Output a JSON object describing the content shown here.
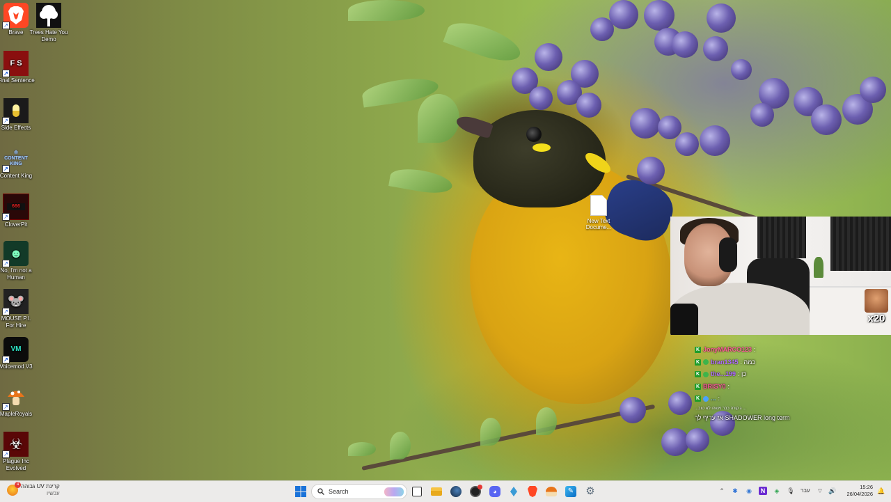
{
  "desktop": {
    "icons": [
      {
        "label": "Brave",
        "icon": "brave-lion-icon",
        "bg": "#ff4724"
      },
      {
        "label": "Trees Hate You Demo",
        "icon": "tree-icon",
        "bg": "#111111"
      },
      {
        "label": "Final Sentence",
        "icon": "fs-logo-icon",
        "bg": "#8a0f0f"
      },
      {
        "label": "Side Effects",
        "icon": "pill-icon",
        "bg": "#1a1a1a"
      },
      {
        "label": "Content King",
        "icon": "crown-logo-icon",
        "bg": "#2b2b6a"
      },
      {
        "label": "CloverPit",
        "icon": "slot-machine-icon",
        "bg": "#3a0d0d"
      },
      {
        "label": "No, I'm not a Human",
        "icon": "face-icon",
        "bg": "#1a3a2a"
      },
      {
        "label": "MOUSE P.I. For Hire",
        "icon": "mouse-detective-icon",
        "bg": "#222222"
      },
      {
        "label": "Voicemod V3",
        "icon": "voicemod-icon",
        "bg": "#0b0b0b"
      },
      {
        "label": "MapleRoyals",
        "icon": "mushroom-icon",
        "bg": "#4b2a12"
      },
      {
        "label": "Plague Inc Evolved",
        "icon": "biohazard-icon",
        "bg": "#4a0707"
      }
    ],
    "newfile_label": "New Text Docume..."
  },
  "webcam": {
    "badge_text": "x20"
  },
  "chat": {
    "messages": [
      {
        "user": "JonyMARCO123",
        "text": ":",
        "color": "#ff5a9a"
      },
      {
        "user": "bran1345",
        "text": ": כמה",
        "color": "#b06cff"
      },
      {
        "user": "the...199",
        "text": ": כן",
        "color": "#b06cff"
      },
      {
        "user": "BRISY0",
        "text": ":",
        "color": "#ff4fa0"
      },
      {
        "user": "...",
        "text": ":",
        "color": "#6ec6ff"
      }
    ],
    "footer_small": "...ג קורה כבר משהו לא טוב ...",
    "footer_big": "אז עדיף לך SHADOWER long term"
  },
  "taskbar": {
    "news_line1": "קרינת UV גבוהה",
    "news_line2": "עכשיו",
    "news_badge": "4",
    "search_placeholder": "Search",
    "apps": [
      {
        "name": "task-view-icon"
      },
      {
        "name": "file-explorer-icon"
      },
      {
        "name": "steam-icon"
      },
      {
        "name": "obs-icon"
      },
      {
        "name": "discord-icon"
      },
      {
        "name": "vpn-icon"
      },
      {
        "name": "brave-browser-icon"
      },
      {
        "name": "maple-app-icon"
      },
      {
        "name": "feather-app-icon"
      },
      {
        "name": "settings-icon"
      }
    ],
    "language": "עבר",
    "time": "15:26",
    "date": "26/04/2026"
  }
}
